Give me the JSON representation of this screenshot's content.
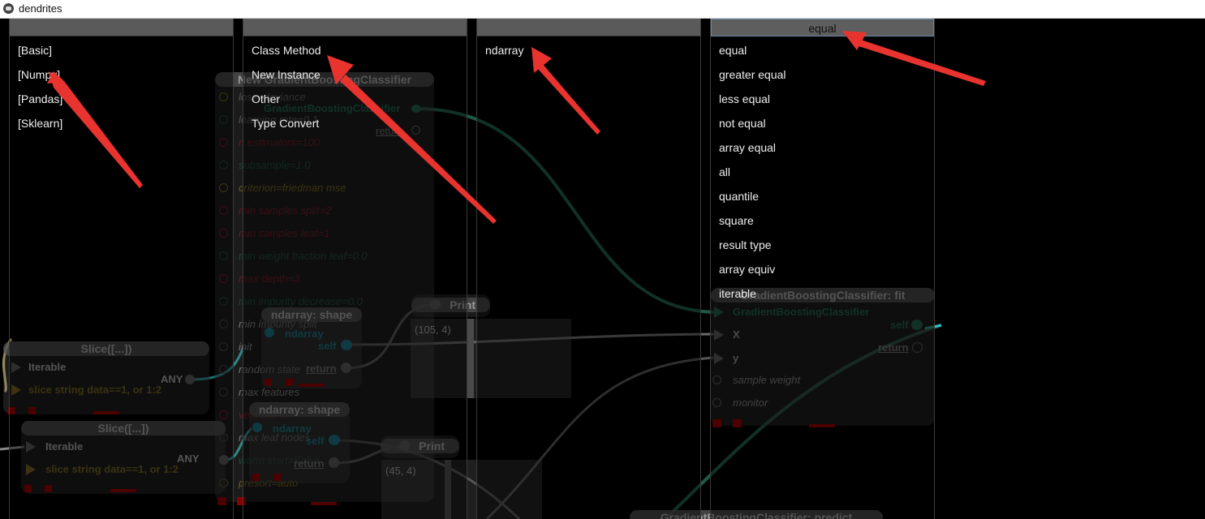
{
  "window": {
    "title": "dendrites"
  },
  "columns": [
    {
      "header": "",
      "items": [
        "[Basic]",
        "[Numpy]",
        "[Pandas]",
        "[Sklearn]"
      ]
    },
    {
      "header": "",
      "items": [
        "Class Method",
        "New Instance",
        "Other",
        "Type Convert"
      ]
    },
    {
      "header": "",
      "items": [
        "ndarray"
      ]
    },
    {
      "header": "equal",
      "items": [
        "equal",
        "greater equal",
        "less equal",
        "not equal",
        "array equal",
        "all",
        "quantile",
        "square",
        "result type",
        "array equiv",
        "iterable"
      ]
    }
  ],
  "nodes": {
    "gbc_new": {
      "title": "New GradientBoostingClassifier",
      "params": [
        "loss=deviance",
        "learning rate=0.1",
        "n estimators=100",
        "subsample=1.0",
        "criterion=friedman mse",
        "min samples split=2",
        "min samples leaf=1",
        "min weight fraction leaf=0.0",
        "max depth=3",
        "min impurity decrease=0.0",
        "min impurity split",
        "init",
        "random state",
        "max features",
        "verbose=0",
        "max leaf nodes",
        "warm start=False",
        "presort=auto"
      ],
      "output": "GradientBoostingClassifier",
      "return_label": "return"
    },
    "slice1": {
      "title": "Slice([...])",
      "in1": "Iterable",
      "in2": "slice string data==1, or 1:2",
      "out": "ANY"
    },
    "slice2": {
      "title": "Slice([...])",
      "in1": "Iterable",
      "in2": "slice string data==1, or 1:2",
      "out": "ANY"
    },
    "shape1": {
      "title": "ndarray: shape",
      "in": "ndarray",
      "self": "self",
      "ret": "return"
    },
    "shape2": {
      "title": "ndarray: shape",
      "in": "ndarray",
      "self": "self",
      "ret": "return"
    },
    "print1": {
      "title": "Print",
      "value": "(105, 4)"
    },
    "print2": {
      "title": "Print",
      "value": "(45, 4)"
    },
    "fit": {
      "title": "GradientBoostingClassifier: fit",
      "in1": "GradientBoostingClassifier",
      "in2": "X",
      "in3": "y",
      "in4": "sample weight",
      "in5": "monitor",
      "self": "self",
      "ret": "return"
    },
    "predict": {
      "title": "GradientBoostingClassifier: predict"
    }
  },
  "colors": {
    "wire_green": "#1f5a48",
    "wire_teal": "#2fc4c4",
    "wire_gray": "#6a6a6a",
    "wire_yellow": "#d7c37a",
    "arrow_red": "#e8332f",
    "accent_red": "#8a0000"
  }
}
